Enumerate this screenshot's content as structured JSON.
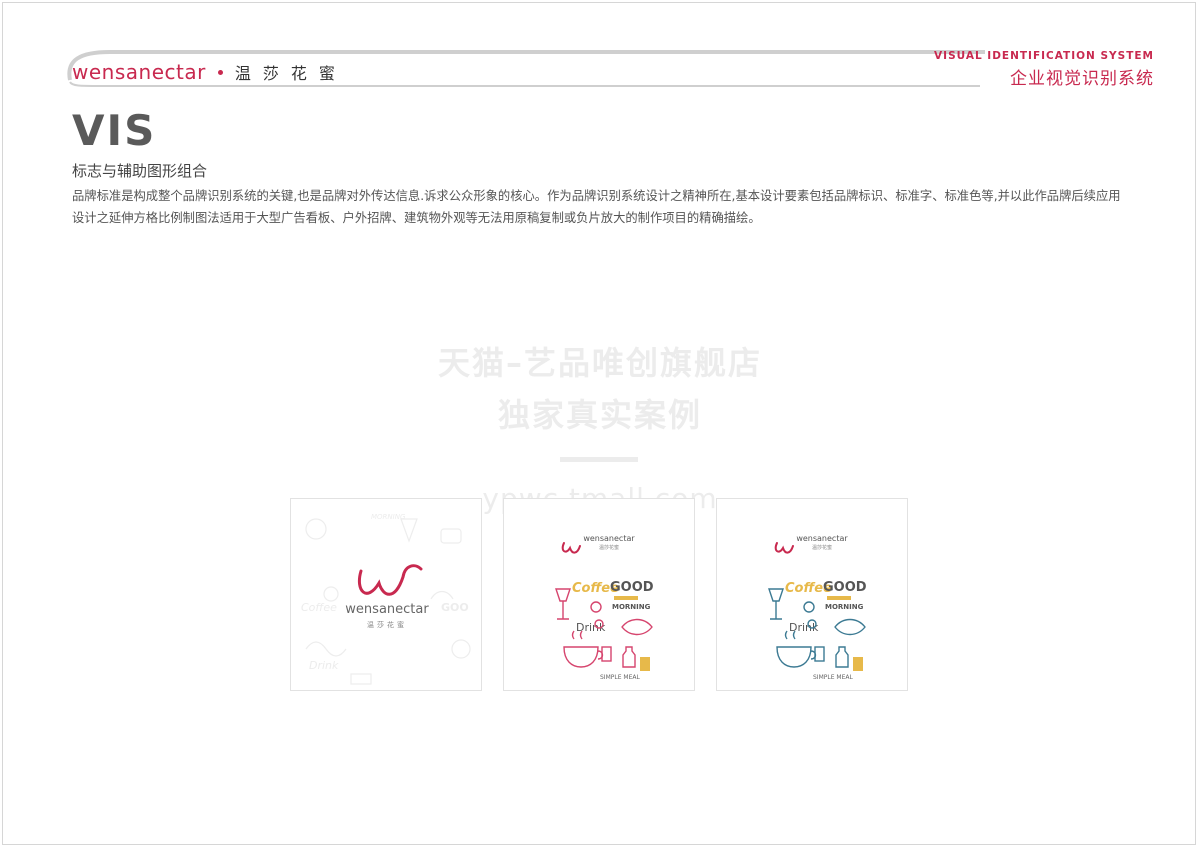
{
  "header": {
    "brand_en": "wensanectar",
    "brand_cn": "温莎花蜜",
    "system_en": "VISUAL IDENTIFICATION SYSTEM",
    "system_cn": "企业视觉识别系统"
  },
  "main": {
    "title": "VIS",
    "subtitle": "标志与辅助图形组合",
    "description": "品牌标准是构成整个品牌识别系统的关键,也是品牌对外传达信息.诉求公众形象的核心。作为品牌识别系统设计之精神所在,基本设计要素包括品牌标识、标准字、标准色等,并以此作品牌后续应用设计之延伸方格比例制图法适用于大型广告看板、户外招牌、建筑物外观等无法用原稿复制或负片放大的制作项目的精确描绘。"
  },
  "watermark": {
    "line1": "天猫–艺品唯创旗舰店",
    "line2": "独家真实案例",
    "line3": "ypwc.tmall.com"
  },
  "cards": [
    {
      "logo_en": "wensanectar",
      "logo_cn": "温莎花蜜",
      "bg_words": [
        "Coffee",
        "GOO",
        "Drink",
        "MORNING"
      ]
    },
    {
      "logo_en": "wensanectar",
      "logo_cn": "温莎花蜜",
      "word_coffee": "Coffee",
      "word_good": "GOOD",
      "word_morning": "MORNING",
      "word_drink": "Drink",
      "word_meal": "SIMPLE MEAL"
    },
    {
      "logo_en": "wensanectar",
      "logo_cn": "温莎花蜜",
      "word_coffee": "Coffee",
      "word_good": "GOOD",
      "word_morning": "MORNING",
      "word_drink": "Drink",
      "word_meal": "SIMPLE MEAL"
    }
  ],
  "colors": {
    "brand": "#c8294f",
    "icon_pink": "#d6456e",
    "icon_blue": "#3c7a93",
    "accent_yellow": "#e7b94a",
    "title_gray": "#5a5a5a"
  }
}
